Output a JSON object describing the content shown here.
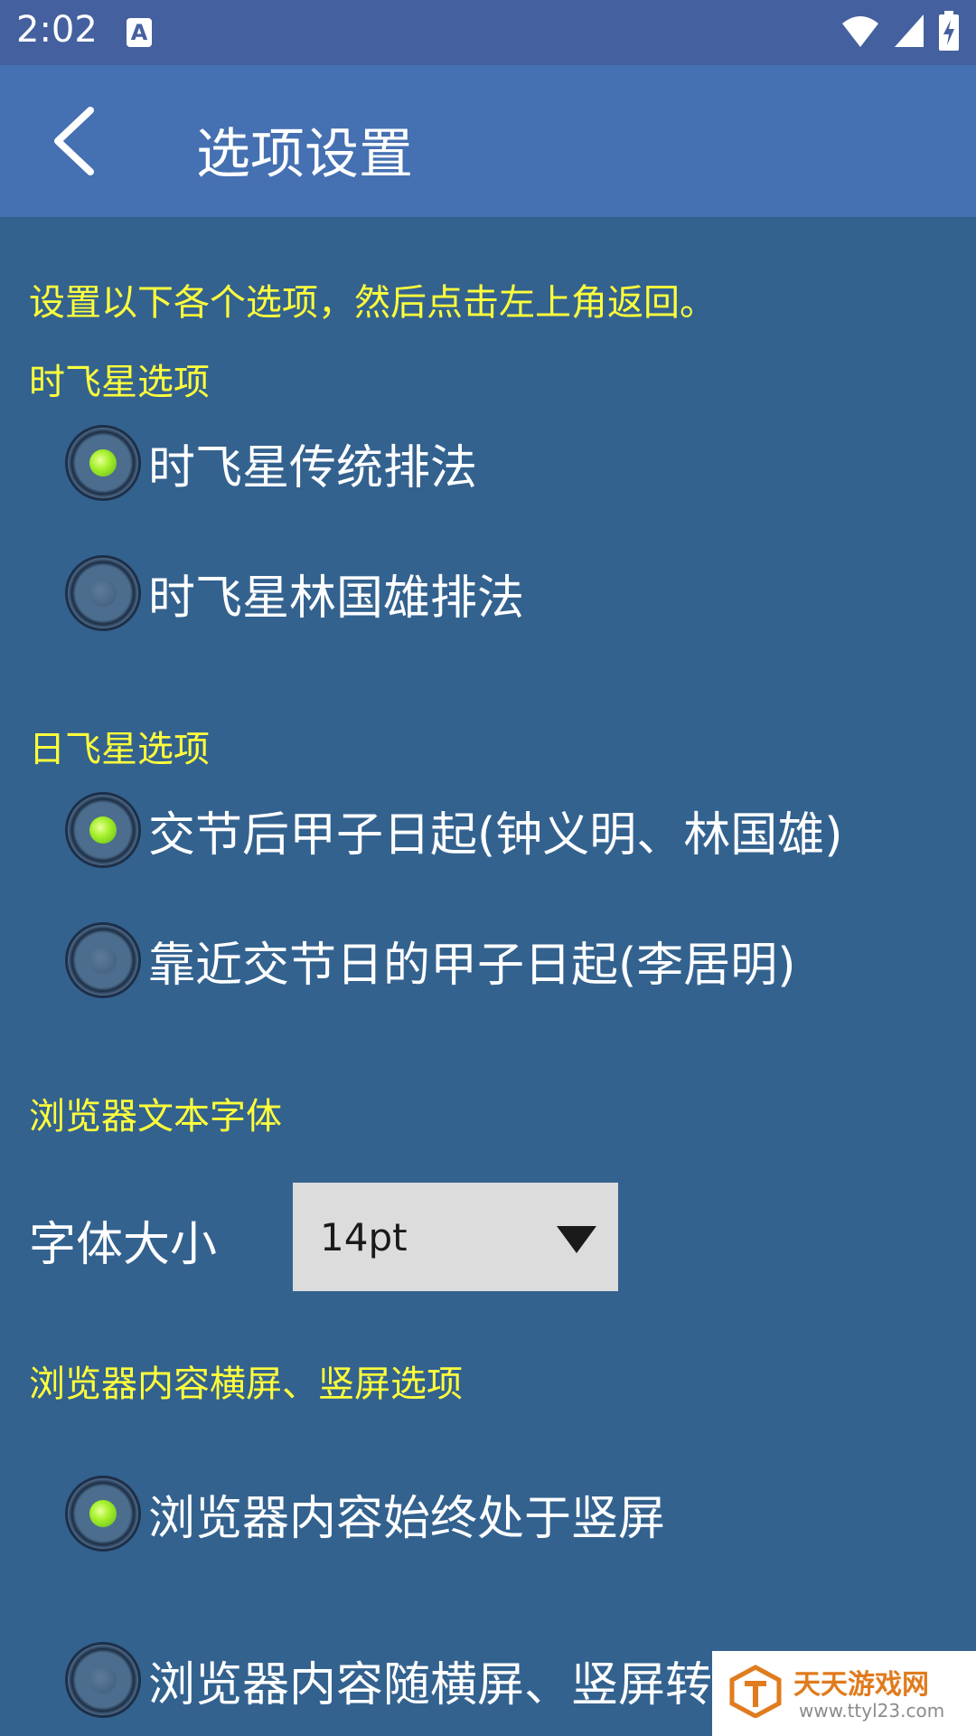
{
  "status_bar": {
    "time": "2:02",
    "notification_icon": "A"
  },
  "app_bar": {
    "title": "选项设置"
  },
  "instruction": "设置以下各个选项，然后点击左上角返回。",
  "sections": {
    "hour_star": {
      "title": "时飞星选项",
      "options": [
        {
          "label": "时飞星传统排法",
          "selected": true
        },
        {
          "label": "时飞星林国雄排法",
          "selected": false
        }
      ]
    },
    "day_star": {
      "title": "日飞星选项",
      "options": [
        {
          "label": "交节后甲子日起(钟义明、林国雄)",
          "selected": true
        },
        {
          "label": "靠近交节日的甲子日起(李居明)",
          "selected": false
        }
      ]
    },
    "browser_font": {
      "title": "浏览器文本字体",
      "font_size_label": "字体大小",
      "font_size_value": "14pt"
    },
    "orientation": {
      "title": "浏览器内容横屏、竖屏选项",
      "options": [
        {
          "label": "浏览器内容始终处于竖屏",
          "selected": true
        },
        {
          "label": "浏览器内容随横屏、竖屏转",
          "selected": false
        }
      ]
    }
  },
  "watermark": {
    "name": "天天游戏网",
    "url": "www.ttyl23.com"
  },
  "colors": {
    "background": "#33628f",
    "app_bar": "#4570b1",
    "status_bar": "#44609f",
    "section_text": "#ffff3b"
  }
}
